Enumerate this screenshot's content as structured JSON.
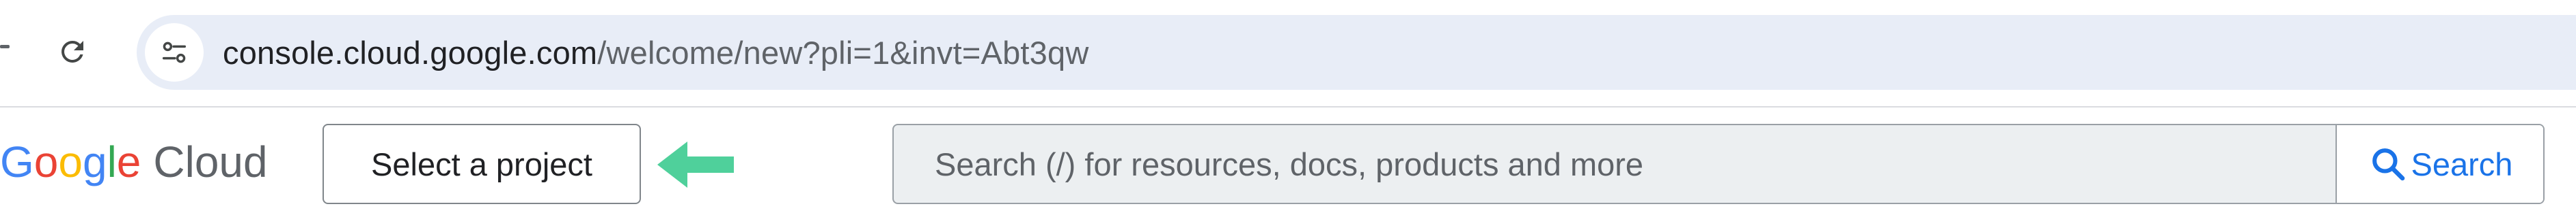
{
  "browser": {
    "url_host": "console.cloud.google.com",
    "url_path": "/welcome/new?pli=1&invt=Abt3qw"
  },
  "console": {
    "logo": {
      "letters": [
        "G",
        "o",
        "o",
        "g",
        "l",
        "e"
      ],
      "letter_colors": [
        "#4285f4",
        "#ea4335",
        "#fbbc04",
        "#4285f4",
        "#34a853",
        "#ea4335"
      ],
      "suffix": "Cloud"
    },
    "project_picker_label": "Select a project",
    "search": {
      "placeholder": "Search (/) for resources, docs, products and more",
      "button_label": "Search"
    }
  },
  "colors": {
    "annotation_arrow": "#4fd09b",
    "accent": "#1a73e8",
    "omnibox_bg": "#e8edf7"
  },
  "icons": {
    "reload": "reload-icon",
    "site_info": "tune-icon",
    "annotation": "arrow-left-icon",
    "search": "search-icon"
  }
}
